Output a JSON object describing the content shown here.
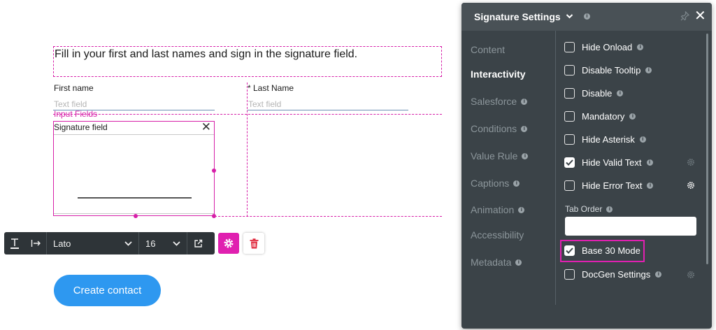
{
  "canvas": {
    "instruction": "Fill in your first and last names and sign in the signature field.",
    "fields": [
      {
        "label": "First name",
        "placeholder": "Text field"
      },
      {
        "label": "* Last Name",
        "placeholder": "Text field"
      }
    ],
    "section_label": "Input Fields",
    "signature": {
      "title": "Signature field"
    },
    "primary_button": "Create contact"
  },
  "toolbar": {
    "font": "Lato",
    "size": "16"
  },
  "panel": {
    "title": "Signature Settings",
    "nav": [
      {
        "label": "Content",
        "info": false,
        "active": false
      },
      {
        "label": "Interactivity",
        "info": false,
        "active": true
      },
      {
        "label": "Salesforce",
        "info": true,
        "active": false
      },
      {
        "label": "Conditions",
        "info": true,
        "active": false
      },
      {
        "label": "Value Rule",
        "info": true,
        "active": false
      },
      {
        "label": "Captions",
        "info": true,
        "active": false
      },
      {
        "label": "Animation",
        "info": true,
        "active": false
      },
      {
        "label": "Accessibility",
        "info": false,
        "active": false
      },
      {
        "label": "Metadata",
        "info": true,
        "active": false
      }
    ],
    "options": [
      {
        "label": "Hide Onload",
        "checked": false,
        "gear": false
      },
      {
        "label": "Disable Tooltip",
        "checked": false,
        "gear": false
      },
      {
        "label": "Disable",
        "checked": false,
        "gear": false
      },
      {
        "label": "Mandatory",
        "checked": false,
        "gear": false
      },
      {
        "label": "Hide Asterisk",
        "checked": false,
        "gear": false
      },
      {
        "label": "Hide Valid Text",
        "checked": true,
        "gear": "dim"
      },
      {
        "label": "Hide Error Text",
        "checked": false,
        "gear": "bright"
      }
    ],
    "tab_order": {
      "label": "Tab Order",
      "value": ""
    },
    "base30": {
      "label": "Base 30 Mode",
      "checked": true
    },
    "docgen": {
      "label": "DocGen Settings",
      "checked": false
    }
  },
  "colors": {
    "accent": "#e020b0",
    "panel_bg": "#3b4348",
    "primary": "#2e98f0"
  }
}
